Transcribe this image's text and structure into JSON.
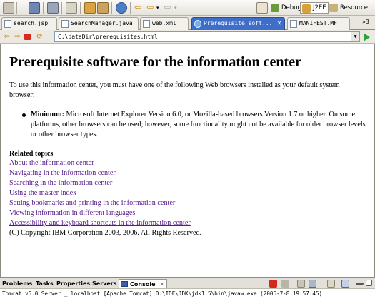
{
  "perspectives": [
    {
      "label": "Debug",
      "icon": "debug-icon"
    },
    {
      "label": "J2EE",
      "icon": "j2ee-icon"
    },
    {
      "label": "Resource",
      "icon": "resource-icon"
    }
  ],
  "editor_tabs": [
    {
      "label": "search.jsp"
    },
    {
      "label": "SearchManager.java"
    },
    {
      "label": "web.xml"
    },
    {
      "label": "Prerequisite soft...",
      "active": true
    },
    {
      "label": "MANIFEST.MF"
    }
  ],
  "tab_overflow": "»3",
  "address": {
    "url": "C:\\dataDir\\prerequisites.html"
  },
  "page": {
    "title": "Prerequisite software for the information center",
    "intro": "To use this information center, you must have one of the following Web browsers installed as your default system browser:",
    "bullet_label": "Minimum:",
    "bullet_text": "Microsoft Internet Explorer Version 6.0, or Mozilla-based browsers Version 1.7 or higher. On some platforms, other browsers can be used; however, some functionality might not be available for older browser levels or other browser types.",
    "related_title": "Related topics",
    "related_links": [
      "About the information center",
      "Navigating in the information center",
      "Searching in the information center",
      "Using the master index",
      "Setting bookmarks and printing in the information center",
      "Viewing information in different languages",
      "Accessibility and keyboard shortcuts in the information center"
    ],
    "copyright": "(C) Copyright IBM Corporation 2003, 2006. All Rights Reserved."
  },
  "bottom_tabs": [
    "Problems",
    "Tasks",
    "Properties",
    "Servers",
    "Console"
  ],
  "console_line": "Tomcat v5.0 Server _ localhost [Apache Tomcat] D:\\IDE\\JDK\\jdk1.5\\bin\\javaw.exe (2006-7-8 19:57:45)"
}
